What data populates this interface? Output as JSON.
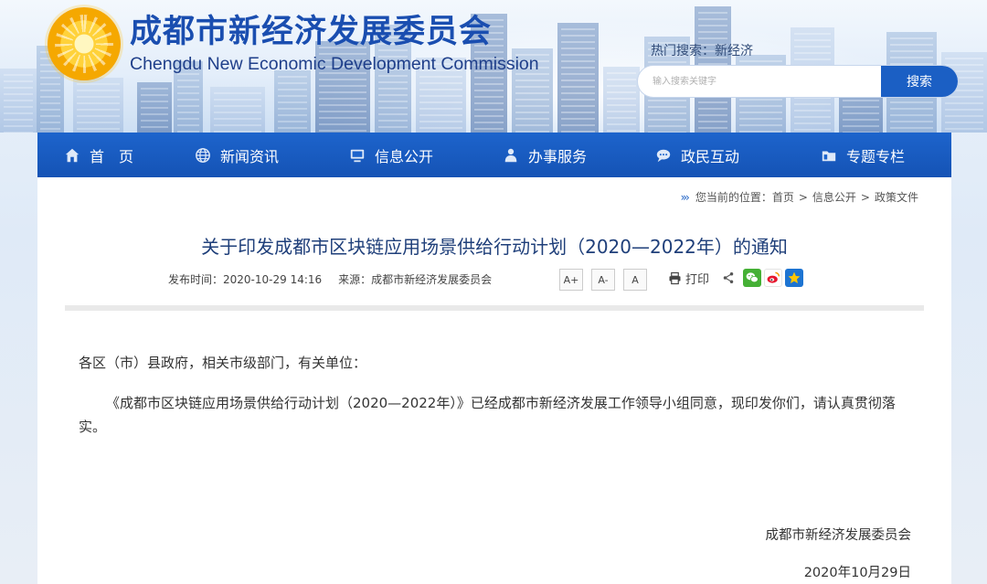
{
  "header": {
    "title_cn": "成都市新经济发展委员会",
    "title_en": "Chengdu New Economic Development Commission",
    "hot_search_label": "热门搜索：",
    "hot_search_term": "新经济",
    "search_placeholder": "输入搜索关键字",
    "search_button": "搜索"
  },
  "nav": {
    "items": [
      {
        "label": "首　页",
        "icon": "home-icon"
      },
      {
        "label": "新闻资讯",
        "icon": "globe-icon"
      },
      {
        "label": "信息公开",
        "icon": "monitor-icon"
      },
      {
        "label": "办事服务",
        "icon": "person-icon"
      },
      {
        "label": "政民互动",
        "icon": "chat-icon"
      },
      {
        "label": "专题专栏",
        "icon": "folder-icon"
      }
    ]
  },
  "breadcrumb": {
    "prefix": "您当前的位置：",
    "items": [
      "首页",
      "信息公开",
      "政策文件"
    ]
  },
  "article": {
    "title": "关于印发成都市区块链应用场景供给行动计划（2020—2022年）的通知",
    "publish_label": "发布时间：",
    "publish_time": "2020-10-29 14:16",
    "source_label": "来源：",
    "source": "成都市新经济发展委员会",
    "font_buttons": [
      "A+",
      "A-",
      "A"
    ],
    "print_label": "打印",
    "salutation": "各区（市）县政府，相关市级部门，有关单位：",
    "paragraph": "《成都市区块链应用场景供给行动计划（2020—2022年）》已经成都市新经济发展工作领导小组同意，现印发你们，请认真贯彻落实。",
    "signature": "成都市新经济发展委员会",
    "date": "2020年10月29日"
  },
  "colors": {
    "nav_bg": "#1d64cc",
    "title_blue": "#1a4eb0",
    "search_button": "#1b5fc4"
  }
}
